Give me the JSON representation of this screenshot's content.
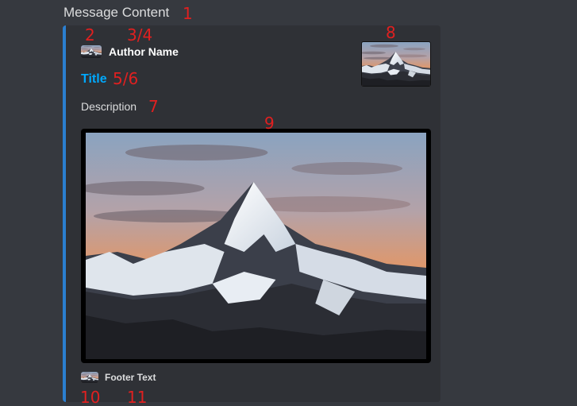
{
  "message": {
    "content": "Message Content"
  },
  "embed": {
    "accent_color": "#2b7fd0",
    "author": {
      "name": "Author Name",
      "icon": "mountain-icon"
    },
    "title": "Title",
    "title_color": "#00a8fc",
    "description": "Description",
    "thumbnail": "mountain-thumbnail",
    "image": "mountain-image",
    "footer": {
      "text": "Footer Text",
      "icon": "mountain-icon"
    }
  },
  "annotations": {
    "message_content": "1",
    "author_icon": "2",
    "author_name": "3/4",
    "title": "5/6",
    "description": "7",
    "thumbnail": "8",
    "image": "9",
    "footer_icon": "10",
    "footer_text": "11"
  }
}
